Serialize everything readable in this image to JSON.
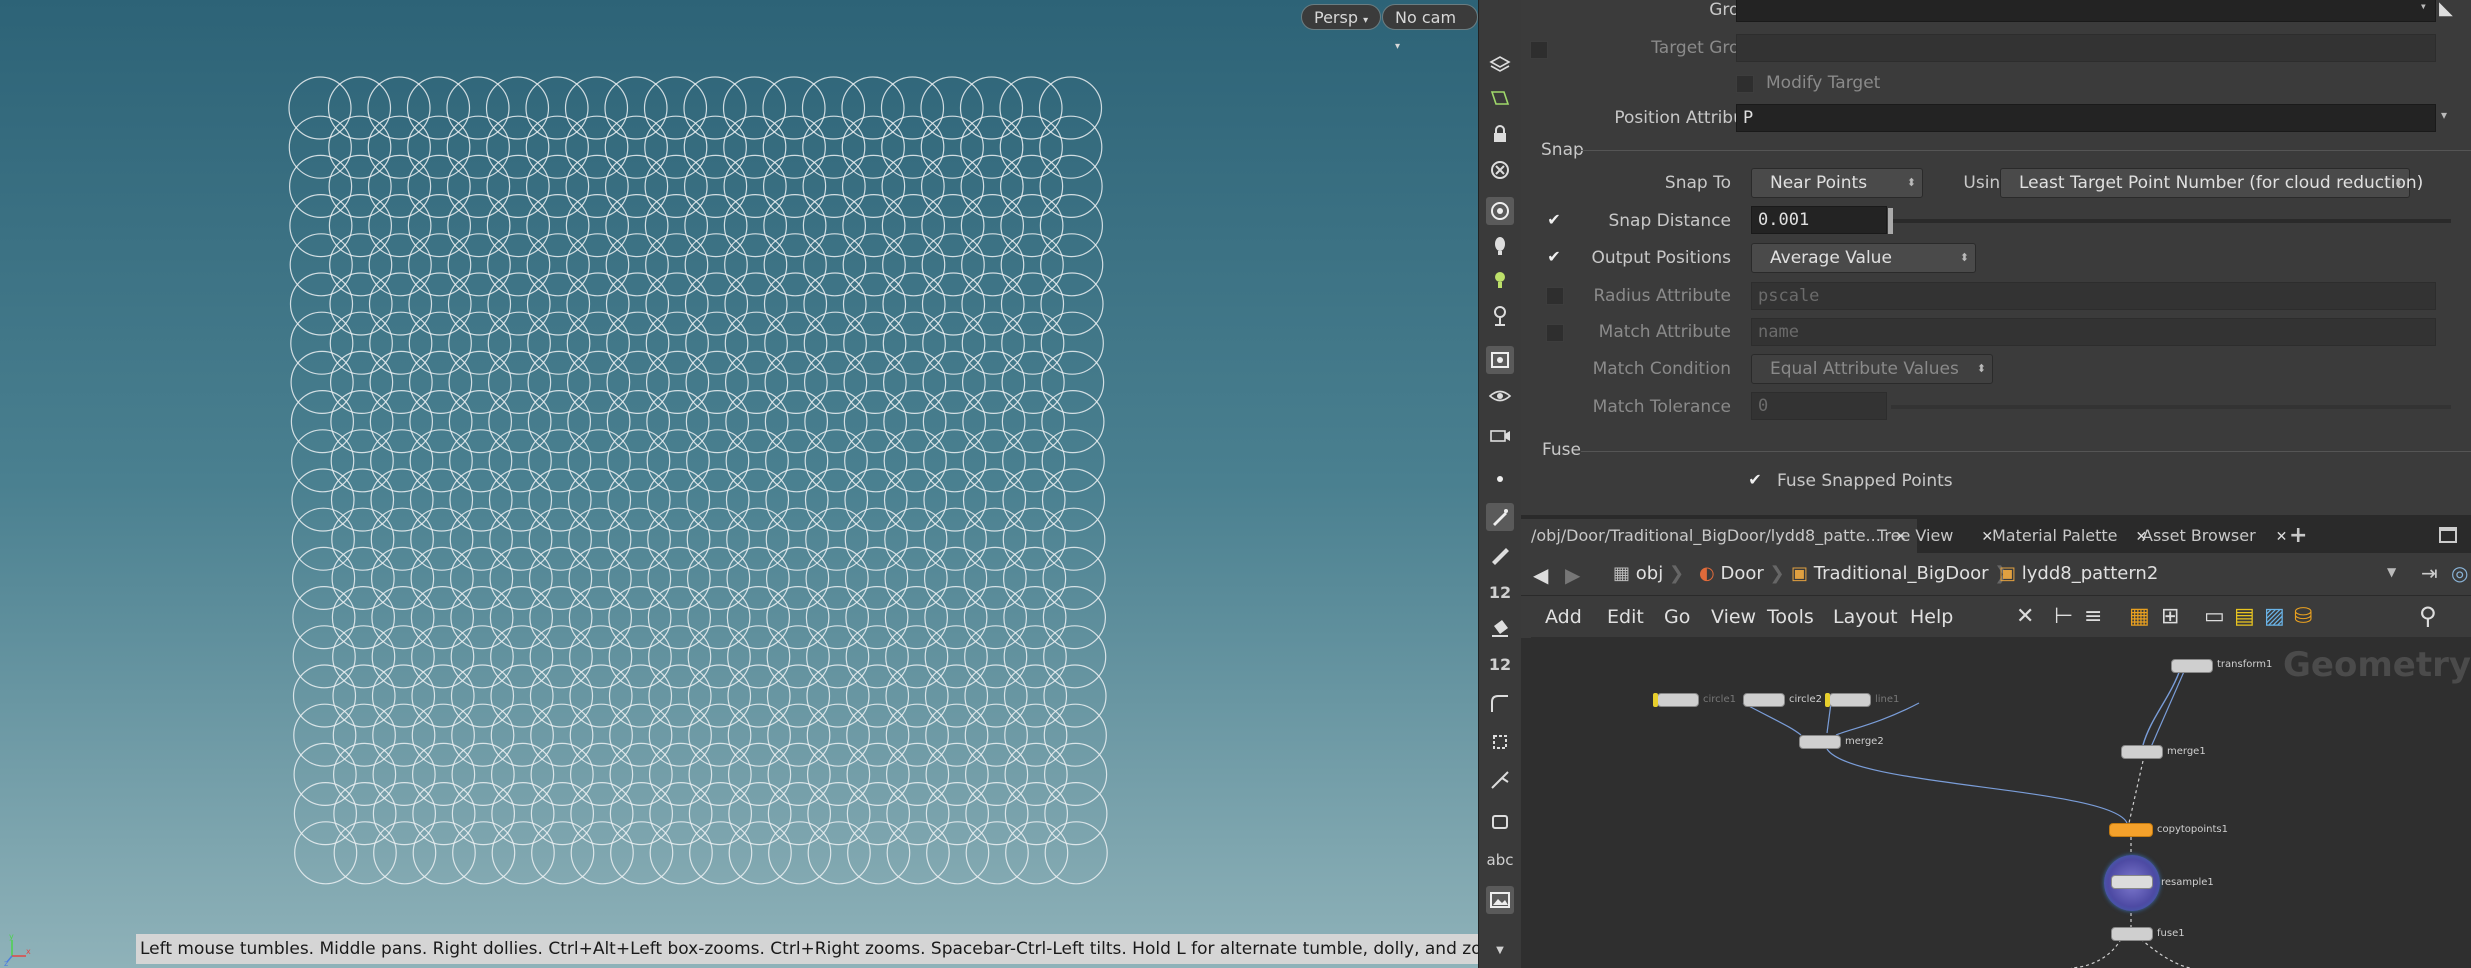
{
  "viewport": {
    "persp_label": "Persp",
    "cam_label": "No cam",
    "status_text": "Left mouse tumbles. Middle pans. Right dollies. Ctrl+Alt+Left box-zooms. Ctrl+Right zooms. Spacebar-Ctrl-Left tilts. Hold L for alternate tumble, dolly, and zoom.",
    "axis": {
      "y": "y",
      "x": "x",
      "z": "z"
    }
  },
  "shelf": {
    "tools": [
      "layers-icon",
      "view-icon",
      "lock-icon",
      "snap-off-icon",
      "camera-icon",
      "light-icon",
      "light-bulb-icon",
      "pin-light-icon",
      "display-icon",
      "eye-icon",
      "render-eye-icon",
      "point-icon",
      "brush-icon",
      "pen-icon",
      "number-12-icon",
      "paint-bucket-icon",
      "number-12b-icon",
      "curve-icon",
      "transform-icon",
      "handle-icon",
      "box-icon",
      "abc-icon",
      "image-icon"
    ],
    "label_12": "12",
    "label_abc": "abc"
  },
  "params": {
    "group_label": "Group",
    "target_group_label": "Target Group",
    "modify_target_label": "Modify Target",
    "position_attribute_label": "Position Attribute",
    "position_attribute_value": "P",
    "snap_section": "Snap",
    "snap_to_label": "Snap To",
    "snap_to_value": "Near Points",
    "using_label": "Using",
    "using_value": "Least Target Point Number (for cloud reduction)",
    "snap_distance_label": "Snap Distance",
    "snap_distance_value": "0.001",
    "output_positions_label": "Output Positions",
    "output_positions_value": "Average Value",
    "radius_attribute_label": "Radius Attribute",
    "radius_attribute_value": "pscale",
    "match_attribute_label": "Match Attribute",
    "match_attribute_value": "name",
    "match_condition_label": "Match Condition",
    "match_condition_value": "Equal Attribute Values",
    "match_tolerance_label": "Match Tolerance",
    "match_tolerance_value": "0",
    "fuse_section": "Fuse",
    "fuse_snapped_label": "Fuse Snapped Points"
  },
  "network": {
    "tabs": [
      {
        "label": "/obj/Door/Traditional_BigDoor/lydd8_patte...",
        "active": true
      },
      {
        "label": "Tree View"
      },
      {
        "label": "Material Palette"
      },
      {
        "label": "Asset Browser"
      }
    ],
    "add_tab": "+",
    "path": [
      "obj",
      "Door",
      "Traditional_BigDoor",
      "lydd8_pattern2"
    ],
    "menu": [
      "Add",
      "Edit",
      "Go",
      "View",
      "Tools",
      "Layout",
      "Help"
    ],
    "context_label": "Geometry",
    "nodes": {
      "transform1": "transform1",
      "merge1": "merge1",
      "circle1": "circle1",
      "circle2": "circle2",
      "line1": "line1",
      "merge2": "merge2",
      "copytopoints1": "copytopoints1",
      "resample1": "resample1",
      "fuse1": "fuse1"
    }
  }
}
